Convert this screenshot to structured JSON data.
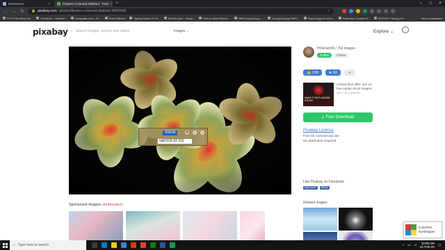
{
  "browser": {
    "tabs": [
      {
        "title": "Extensions",
        "active": false,
        "favicon": "puzzle-icon"
      },
      {
        "title": "Flowers Coloured Abstract - Free",
        "active": true,
        "favicon": "pixabay-icon"
      }
    ],
    "url_domain": "pixabay.com",
    "url_path": "/photos/flowers-coloured-abstract-4836548/",
    "bookmarks": [
      "21 Of The Most Int...",
      "Coinfinex – Movers...",
      "Computer.com – R...",
      "Scam Bitcoin",
      "Typing Speed 70 W...",
      "Mlnefin jobs - Goog...",
      "How to mine Ethere...",
      "999G psychology -...",
      "ex psychology 999G...",
      "Psychology A-Level...",
      "Ethereum Classic M...",
      "BUYING Trading Sit..."
    ],
    "bookmarks_other": "Other bookmarks"
  },
  "site": {
    "logo": "pixabay",
    "search_placeholder": "Search images, vectors and videos",
    "search_filter": "Images ⌄",
    "explore": "Explore ⌄"
  },
  "picker": {
    "hex": "769035",
    "rgb": "rgb(118,92,53)"
  },
  "sponsored": {
    "label": "Sponsored Images",
    "brand": "shutterstock"
  },
  "sidebar": {
    "author_name": "HOerwin56 / 752 images",
    "coffee": "Coffee",
    "follow": "Follow",
    "likes": "139",
    "favorites": "63",
    "ad_image_text": "MAKE IT WITH ADOBE STOCK",
    "ad_text": "Limited time offer: Get 10 free Adobe Stock images.",
    "ad_via": "ADS VIA CARBON",
    "download": "Free Download",
    "license_title": "Pixabay License",
    "license_lines": [
      "Free for commercial use",
      "No attribution required"
    ],
    "facebook_title": "Like Pixabay on Facebook",
    "fb_like": "Like 411K",
    "fb_share": "Share",
    "related_title": "Related images"
  },
  "widget": {
    "line1": "ColorPick",
    "line2": "Eyedropper"
  },
  "taskbar": {
    "search_placeholder": "Type here to search",
    "time": "10:08 AM",
    "date": "21-Feb-20"
  },
  "colors": {
    "accent_green": "#2ec66d",
    "accent_blue": "#3b7ed7",
    "picked_color": "#765c35"
  }
}
